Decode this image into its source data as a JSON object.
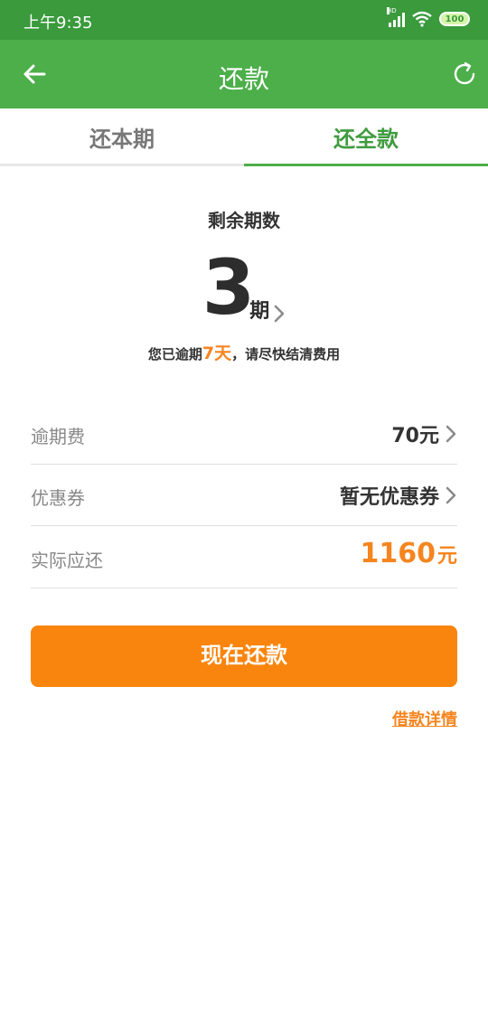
{
  "status_bar": {
    "time": "上午9:35",
    "battery": "100",
    "network": "HD"
  },
  "app_bar": {
    "title": "还款"
  },
  "tabs": [
    {
      "label": "还本期",
      "active": false
    },
    {
      "label": "还全款",
      "active": true
    }
  ],
  "summary": {
    "remaining_label": "剩余期数",
    "remaining_count": "3",
    "remaining_unit": "期",
    "overdue_prefix": "您已逾期",
    "overdue_days": "7天",
    "overdue_suffix": "，请尽快结清费用"
  },
  "rows": {
    "late_fee": {
      "label": "逾期费",
      "value": "70元"
    },
    "coupon": {
      "label": "优惠券",
      "value": "暂无优惠券"
    },
    "actual_due": {
      "label": "实际应还",
      "amount": "1160",
      "unit": "元"
    }
  },
  "actions": {
    "pay_now": "现在还款",
    "loan_detail": "借款详情"
  },
  "colors": {
    "green_dark": "#3a9a3c",
    "green": "#4caf4a",
    "orange": "#f9850e"
  }
}
